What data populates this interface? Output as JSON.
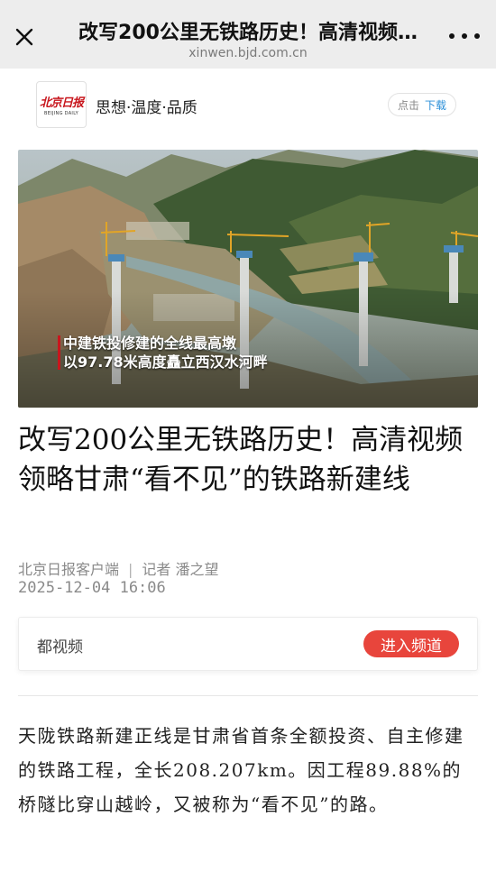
{
  "topbar": {
    "title": "改写200公里无铁路历史！高清视频…",
    "url": "xinwen.bjd.com.cn"
  },
  "icons": {
    "close": "close-icon",
    "more": "more-icon"
  },
  "brand": {
    "logo_cn": "北京日报",
    "logo_en": "BEIJING DAILY",
    "slogan": "思想·温度·品质",
    "download_prefix": "点击",
    "download_label": "下载"
  },
  "hero": {
    "caption_line1": "中建铁投修建的全线最高墩",
    "caption_line2": "以97.78米高度矗立西汉水河畔"
  },
  "article": {
    "headline": "改写200公里无铁路历史！高清视频领略甘肃“看不见”的铁路新建线",
    "source": "北京日报客户端",
    "separator": "|",
    "reporter": "记者 潘之望",
    "date": "2025-12-04 16:06",
    "body": "天陇铁路新建正线是甘肃省首条全额投资、自主修建的铁路工程，全长208.207km。因工程89.88%的桥隧比穿山越岭，又被称为“看不见”的路。"
  },
  "channel": {
    "name": "都视频",
    "button": "进入频道"
  },
  "colors": {
    "accent_red": "#e8453c",
    "link_blue": "#2b8fd8",
    "logo_red": "#c8161d"
  }
}
